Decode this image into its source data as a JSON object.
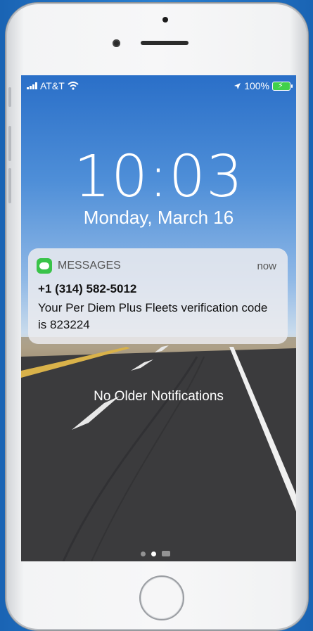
{
  "status_bar": {
    "carrier": "AT&T",
    "battery_percent": "100%",
    "signal_bars": 4,
    "location_icon": "location-arrow-icon",
    "wifi_icon": "wifi-icon"
  },
  "lock_screen": {
    "time": "10:03",
    "date": "Monday, March 16"
  },
  "notification": {
    "app_name": "MESSAGES",
    "timestamp": "now",
    "sender": "+1 (314) 582-5012",
    "message": "Your Per Diem Plus Fleets verification code is 823224",
    "icon_color": "#39c349"
  },
  "footer": {
    "no_older_text": "No Older Notifications",
    "page_count": 2,
    "active_page": 2
  }
}
